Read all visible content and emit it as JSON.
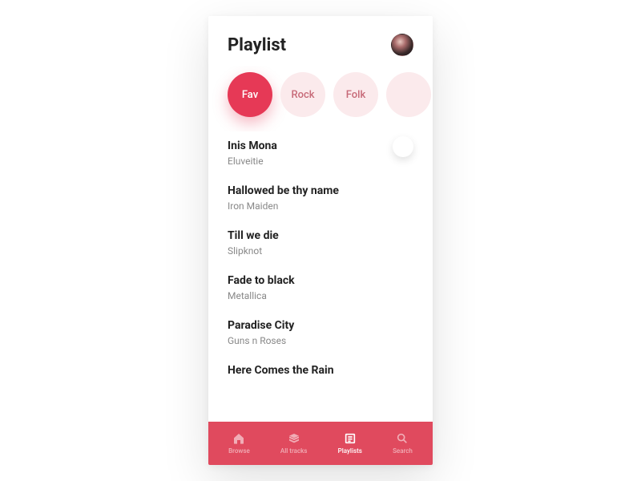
{
  "header": {
    "title": "Playlist"
  },
  "chips": [
    {
      "label": "Fav",
      "active": true
    },
    {
      "label": "Rock",
      "active": false
    },
    {
      "label": "Folk",
      "active": false
    },
    {
      "label": "",
      "active": false
    }
  ],
  "tracks": [
    {
      "title": "Inis Mona",
      "artist": "Eluveitie",
      "showPlay": true
    },
    {
      "title": "Hallowed be thy name",
      "artist": "Iron Maiden",
      "showPlay": false
    },
    {
      "title": "Till we die",
      "artist": "Slipknot",
      "showPlay": false
    },
    {
      "title": "Fade to black",
      "artist": "Metallica",
      "showPlay": false
    },
    {
      "title": "Paradise City",
      "artist": "Guns n Roses",
      "showPlay": false
    },
    {
      "title": "Here Comes the Rain",
      "artist": "",
      "showPlay": false
    }
  ],
  "nav": [
    {
      "label": "Browse",
      "icon": "home",
      "active": false
    },
    {
      "label": "All tracks",
      "icon": "stack",
      "active": false
    },
    {
      "label": "Playlists",
      "icon": "list",
      "active": true
    },
    {
      "label": "Search",
      "icon": "search",
      "active": false
    }
  ]
}
